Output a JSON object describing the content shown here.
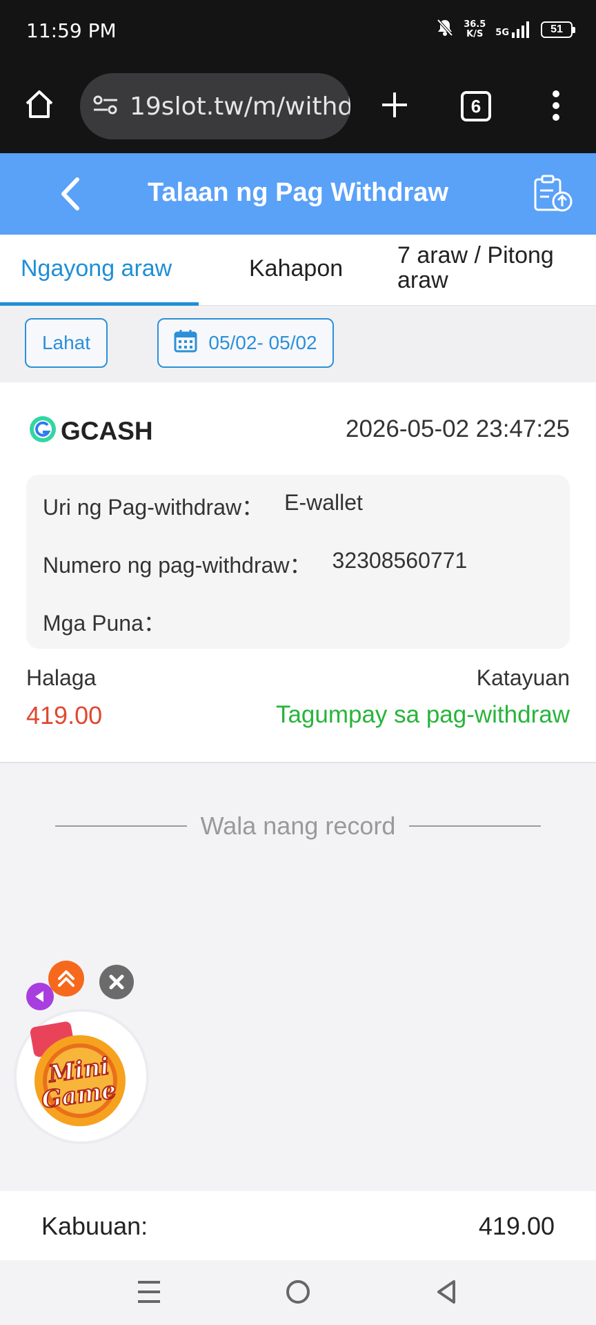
{
  "status_bar": {
    "time": "11:59 PM",
    "net_speed_value": "36.5",
    "net_speed_unit": "K/S",
    "network": "5G",
    "battery": "51"
  },
  "browser": {
    "url": "19slot.tw/m/withd",
    "tab_count": "6"
  },
  "header": {
    "title": "Talaan ng Pag Withdraw"
  },
  "tabs": [
    {
      "label": "Ngayong araw",
      "active": true
    },
    {
      "label": "Kahapon",
      "active": false
    },
    {
      "label": "7 araw / Pitong araw",
      "active": false
    }
  ],
  "filters": {
    "all_label": "Lahat",
    "date_range": "05/02- 05/02"
  },
  "record": {
    "provider": "GCASH",
    "datetime": "2026-05-02 23:47:25",
    "type_label": "Uri ng Pag-withdraw：",
    "type_value": "E-wallet",
    "number_label": "Numero ng pag-withdraw：",
    "number_value": "32308560771",
    "remarks_label": "Mga Puna：",
    "remarks_value": "",
    "amount_label": "Halaga",
    "amount_value": "419.00",
    "status_label": "Katayuan",
    "status_value": "Tagumpay sa pag-withdraw"
  },
  "no_more_text": "Wala nang record",
  "mini_game": {
    "logo_text": "Mini Game"
  },
  "total": {
    "label": "Kabuuan:",
    "value": "419.00"
  },
  "colors": {
    "header_bg": "#5aa1f8",
    "accent": "#1f8fd6",
    "amount": "#e0482f",
    "success": "#27b43a"
  }
}
